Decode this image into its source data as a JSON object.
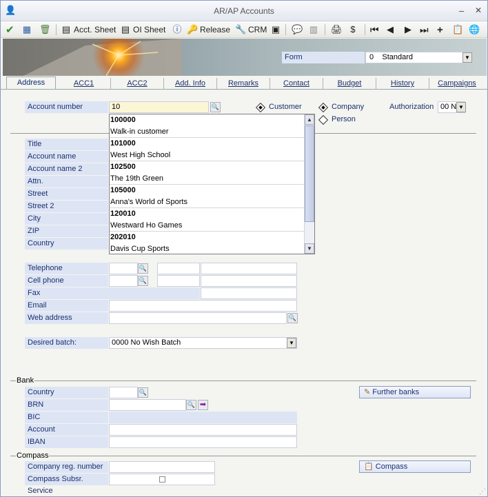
{
  "window": {
    "title": "AR/AP Accounts",
    "min_label": "–",
    "close_label": "✕"
  },
  "toolbar": {
    "acct_sheet": "Acct. Sheet",
    "oi_sheet": "OI Sheet",
    "release": "Release",
    "crm": "CRM"
  },
  "form": {
    "label": "Form",
    "number": "0",
    "value": "Standard"
  },
  "tabs": [
    "Address",
    "ACC1",
    "ACC2",
    "Add. Info",
    "Remarks",
    "Contact",
    "Budget",
    "History",
    "Campaigns"
  ],
  "header": {
    "account_number_label": "Account number",
    "account_number_value": "10",
    "customer_label": "Customer",
    "company_label": "Company",
    "person_label": "Person",
    "authorization_label": "Authorization",
    "authorization_value": "00 N"
  },
  "address": {
    "labels": [
      "Title",
      "Account name",
      "Account name 2",
      "Attn.",
      "Street",
      "Street 2",
      "City",
      "ZIP",
      "Country"
    ]
  },
  "contact": {
    "telephone": "Telephone",
    "cell_phone": "Cell phone",
    "fax": "Fax",
    "email": "Email",
    "web_address": "Web address",
    "desired_batch_label": "Desired batch:",
    "desired_batch_value": "0000 No Wish Batch"
  },
  "bank": {
    "group": "Bank",
    "country": "Country",
    "brn": "BRN",
    "bic": "BIC",
    "account": "Account",
    "iban": "IBAN",
    "further_banks": "Further banks"
  },
  "compass": {
    "group": "Compass",
    "reg_number": "Company reg. number",
    "subsr_service": "Compass Subsr. Service",
    "button": "Compass"
  },
  "dropdown": {
    "items": [
      {
        "number": "100000",
        "name": "Walk-in customer"
      },
      {
        "number": "101000",
        "name": "West High School"
      },
      {
        "number": "102500",
        "name": "The 19th Green"
      },
      {
        "number": "105000",
        "name": "Anna's World of Sports"
      },
      {
        "number": "120010",
        "name": "Westward Ho Games"
      },
      {
        "number": "202010",
        "name": "Davis Cup Sports"
      }
    ]
  }
}
